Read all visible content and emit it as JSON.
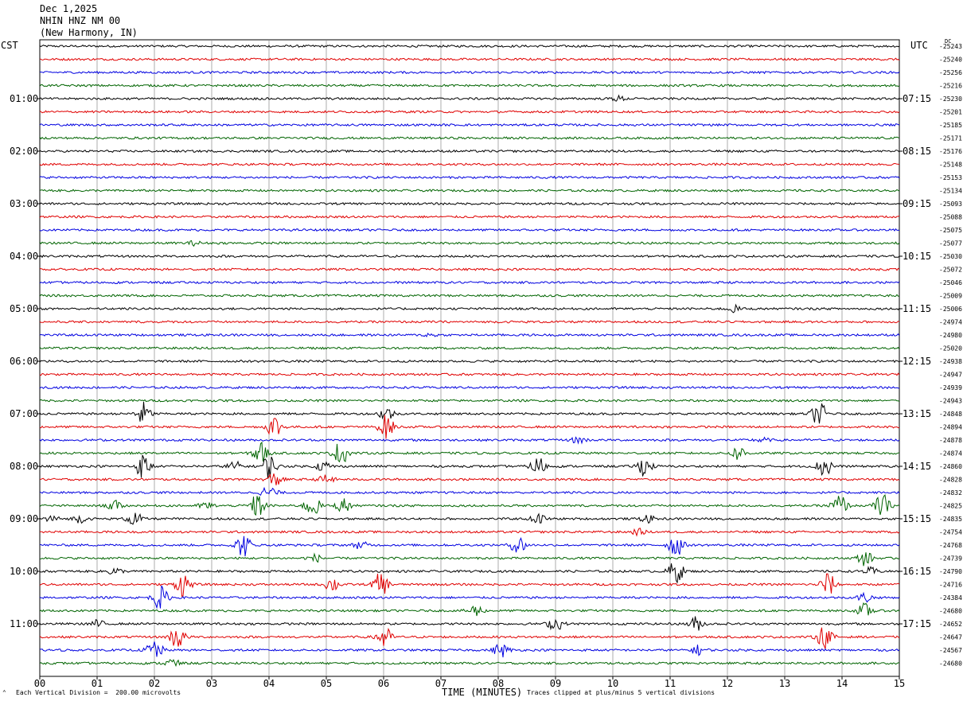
{
  "header": {
    "date": "Dec 1,2025",
    "station": "NHIN HNZ NM 00",
    "location": "(New Harmony, IN)"
  },
  "left_zone_label": "CST",
  "right_zone_label": "UTC",
  "dc_label": "DC",
  "footer": {
    "division_note": "Each Vertical Division =  200.00 microvolts",
    "clip_note": "Traces clipped at plus/minus 5 vertical divisions",
    "x_title": "TIME (MINUTES)"
  },
  "chart_data": {
    "type": "line",
    "title": "",
    "xlabel": "TIME (MINUTES)",
    "xlim": [
      0,
      15
    ],
    "x_ticks": [
      "00",
      "01",
      "02",
      "03",
      "04",
      "05",
      "06",
      "07",
      "08",
      "09",
      "10",
      "11",
      "12",
      "13",
      "14",
      "15"
    ],
    "left_time_labels": [
      "01:00",
      "02:00",
      "03:00",
      "04:00",
      "05:00",
      "06:00",
      "07:00",
      "08:00",
      "09:00",
      "10:00",
      "11:00"
    ],
    "right_time_labels": [
      "07:15",
      "08:15",
      "09:15",
      "10:15",
      "11:15",
      "12:15",
      "13:15",
      "14:15",
      "15:15",
      "16:15",
      "17:15"
    ],
    "trace_colors": [
      "#000000",
      "#e00000",
      "#0000e0",
      "#006400"
    ],
    "trace_count": 48,
    "traces_per_hour": 4,
    "dc_values": [
      "-25243",
      "-25240",
      "-25256",
      "-25216",
      "-25230",
      "-25201",
      "-25185",
      "-25171",
      "-25176",
      "-25148",
      "-25153",
      "-25134",
      "-25093",
      "-25088",
      "-25075",
      "-25077",
      "-25030",
      "-25072",
      "-25046",
      "-25009",
      "-25006",
      "-24974",
      "-24980",
      "-25020",
      "-24938",
      "-24947",
      "-24939",
      "-24943",
      "-24848",
      "-24894",
      "-24878",
      "-24874",
      "-24860",
      "-24828",
      "-24832",
      "-24825",
      "-24835",
      "-24754",
      "-24768",
      "-24739",
      "-24790",
      "-24716",
      "-24384",
      "-24680",
      "-24652",
      "-24647",
      "-24567",
      "-24680"
    ],
    "events": [
      {
        "trace": 4,
        "minute": 10.1,
        "amplitude": 1.0
      },
      {
        "trace": 15,
        "minute": 2.7,
        "amplitude": 0.8
      },
      {
        "trace": 20,
        "minute": 12.1,
        "amplitude": 1.4
      },
      {
        "trace": 22,
        "minute": 6.8,
        "amplitude": 0.7
      },
      {
        "trace": 28,
        "minute": 1.8,
        "amplitude": 5
      },
      {
        "trace": 28,
        "minute": 6.05,
        "amplitude": 3
      },
      {
        "trace": 28,
        "minute": 13.6,
        "amplitude": 5
      },
      {
        "trace": 29,
        "minute": 4.1,
        "amplitude": 5
      },
      {
        "trace": 29,
        "minute": 6.05,
        "amplitude": 5
      },
      {
        "trace": 30,
        "minute": 9.4,
        "amplitude": 1.4
      },
      {
        "trace": 30,
        "minute": 12.6,
        "amplitude": 1.0
      },
      {
        "trace": 31,
        "minute": 3.85,
        "amplitude": 5
      },
      {
        "trace": 31,
        "minute": 5.25,
        "amplitude": 5
      },
      {
        "trace": 31,
        "minute": 12.2,
        "amplitude": 3
      },
      {
        "trace": 32,
        "minute": 1.8,
        "amplitude": 5
      },
      {
        "trace": 32,
        "minute": 3.4,
        "amplitude": 2
      },
      {
        "trace": 32,
        "minute": 4.0,
        "amplitude": 5
      },
      {
        "trace": 32,
        "minute": 4.95,
        "amplitude": 2.2
      },
      {
        "trace": 32,
        "minute": 8.7,
        "amplitude": 4
      },
      {
        "trace": 32,
        "minute": 10.55,
        "amplitude": 4
      },
      {
        "trace": 32,
        "minute": 13.7,
        "amplitude": 5
      },
      {
        "trace": 33,
        "minute": 4.1,
        "amplitude": 3
      },
      {
        "trace": 33,
        "minute": 5.0,
        "amplitude": 2
      },
      {
        "trace": 34,
        "minute": 4.0,
        "amplitude": 3
      },
      {
        "trace": 35,
        "minute": 1.3,
        "amplitude": 2
      },
      {
        "trace": 35,
        "minute": 2.9,
        "amplitude": 1.5
      },
      {
        "trace": 35,
        "minute": 3.8,
        "amplitude": 5
      },
      {
        "trace": 35,
        "minute": 4.75,
        "amplitude": 5
      },
      {
        "trace": 35,
        "minute": 5.3,
        "amplitude": 3
      },
      {
        "trace": 35,
        "minute": 13.95,
        "amplitude": 5
      },
      {
        "trace": 35,
        "minute": 14.7,
        "amplitude": 5
      },
      {
        "trace": 36,
        "minute": 0.2,
        "amplitude": 1.5
      },
      {
        "trace": 36,
        "minute": 0.7,
        "amplitude": 1.5
      },
      {
        "trace": 36,
        "minute": 1.65,
        "amplitude": 3
      },
      {
        "trace": 36,
        "minute": 8.7,
        "amplitude": 2
      },
      {
        "trace": 36,
        "minute": 10.6,
        "amplitude": 1.5
      },
      {
        "trace": 37,
        "minute": 10.45,
        "amplitude": 1.2
      },
      {
        "trace": 38,
        "minute": 3.55,
        "amplitude": 5
      },
      {
        "trace": 38,
        "minute": 5.6,
        "amplitude": 1.5
      },
      {
        "trace": 38,
        "minute": 8.35,
        "amplitude": 4
      },
      {
        "trace": 38,
        "minute": 11.1,
        "amplitude": 5
      },
      {
        "trace": 39,
        "minute": 4.8,
        "amplitude": 1.5
      },
      {
        "trace": 39,
        "minute": 14.4,
        "amplitude": 3
      },
      {
        "trace": 40,
        "minute": 1.3,
        "amplitude": 1.5
      },
      {
        "trace": 40,
        "minute": 11.1,
        "amplitude": 5
      },
      {
        "trace": 40,
        "minute": 14.5,
        "amplitude": 1.5
      },
      {
        "trace": 41,
        "minute": 2.5,
        "amplitude": 5
      },
      {
        "trace": 41,
        "minute": 5.1,
        "amplitude": 3
      },
      {
        "trace": 41,
        "minute": 5.95,
        "amplitude": 5
      },
      {
        "trace": 41,
        "minute": 13.75,
        "amplitude": 5
      },
      {
        "trace": 42,
        "minute": 2.1,
        "amplitude": 5
      },
      {
        "trace": 42,
        "minute": 14.4,
        "amplitude": 2
      },
      {
        "trace": 43,
        "minute": 7.6,
        "amplitude": 2.5
      },
      {
        "trace": 43,
        "minute": 14.4,
        "amplitude": 3
      },
      {
        "trace": 44,
        "minute": 1.0,
        "amplitude": 1.5
      },
      {
        "trace": 44,
        "minute": 9.0,
        "amplitude": 3
      },
      {
        "trace": 44,
        "minute": 11.45,
        "amplitude": 3
      },
      {
        "trace": 45,
        "minute": 2.4,
        "amplitude": 5
      },
      {
        "trace": 45,
        "minute": 6.0,
        "amplitude": 5
      },
      {
        "trace": 45,
        "minute": 13.7,
        "amplitude": 5
      },
      {
        "trace": 46,
        "minute": 2.0,
        "amplitude": 5
      },
      {
        "trace": 46,
        "minute": 8.05,
        "amplitude": 3
      },
      {
        "trace": 46,
        "minute": 11.5,
        "amplitude": 2
      },
      {
        "trace": 47,
        "minute": 2.3,
        "amplitude": 2
      }
    ]
  }
}
